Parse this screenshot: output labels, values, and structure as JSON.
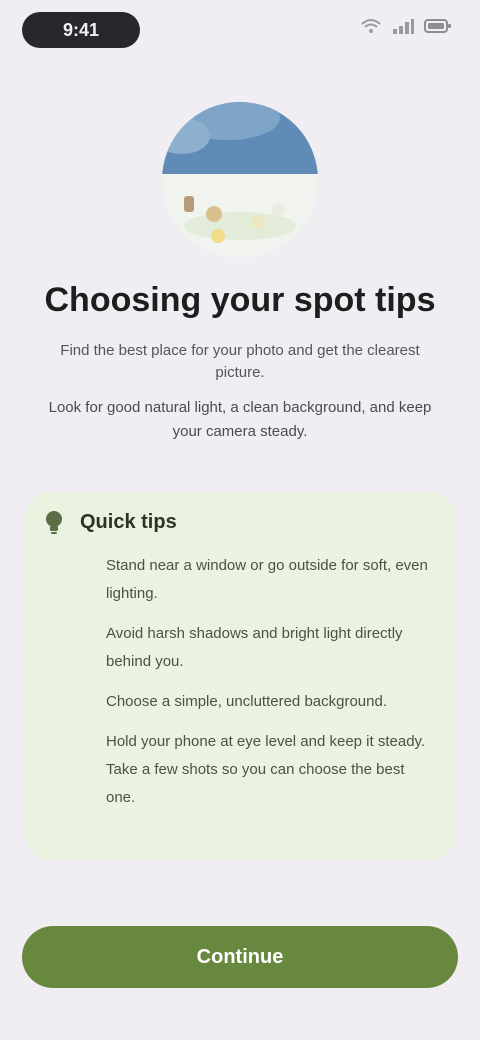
{
  "status_bar": {
    "time": "9:41",
    "icons": [
      "wifi-icon",
      "signal-icon",
      "battery-icon"
    ]
  },
  "hero": {
    "icon": "scenery-illustration-icon"
  },
  "title": "Choosing your spot tips",
  "subtitle": "Find the best place for your photo and get the clearest picture.",
  "description": "Look for good natural light, a clean background, and keep your camera steady.",
  "tips": {
    "title": "Quick tips",
    "icon": "lightbulb-icon",
    "items": [
      "Stand near a window or go outside for soft, even lighting.",
      "Avoid harsh shadows and bright light directly behind you.",
      "Choose a simple, uncluttered background.",
      "Hold your phone at eye level and keep it steady. Take a few shots so you can choose the best one."
    ]
  },
  "cta": {
    "label": "Continue"
  },
  "colors": {
    "background": "#f0edf3",
    "card": "#eaf3df",
    "accent": "#69883f",
    "sky": "#5f8bb6"
  }
}
